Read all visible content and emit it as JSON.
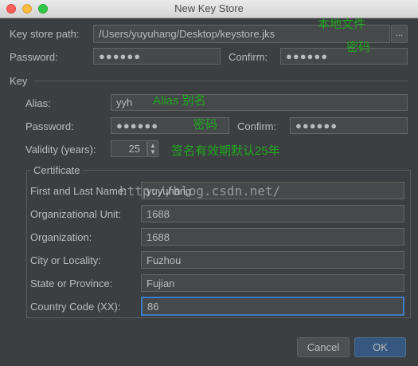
{
  "window": {
    "title": "New Key Store"
  },
  "keystore": {
    "path_label": "Key store path:",
    "path_value": "/Users/yuyuhang/Desktop/keystore.jks",
    "browse_label": "...",
    "password_label": "Password:",
    "password_value": "●●●●●●",
    "confirm_label": "Confirm:",
    "confirm_value": "●●●●●●"
  },
  "key": {
    "section_label": "Key",
    "alias_label": "Alias:",
    "alias_value": "yyh",
    "password_label": "Password:",
    "password_value": "●●●●●●",
    "confirm_label": "Confirm:",
    "confirm_value": "●●●●●●",
    "validity_label": "Validity (years):",
    "validity_value": "25"
  },
  "certificate": {
    "legend": "Certificate",
    "fields": [
      {
        "label": "First and Last Name:",
        "value": "yuyuhang"
      },
      {
        "label": "Organizational Unit:",
        "value": "1688"
      },
      {
        "label": "Organization:",
        "value": "1688"
      },
      {
        "label": "City or Locality:",
        "value": "Fuzhou"
      },
      {
        "label": "State or Province:",
        "value": "Fujian"
      },
      {
        "label": "Country Code (XX):",
        "value": "86"
      }
    ]
  },
  "annotations": {
    "local_file": "本地文件",
    "keystore_password": "密码",
    "alias_note": "Alias 别名",
    "key_password": "密码",
    "validity_note": "签名有效期默认25年"
  },
  "watermark": "http://blog.csdn.net/",
  "buttons": {
    "cancel": "Cancel",
    "ok": "OK"
  },
  "colors": {
    "accent": "#3d7cc4",
    "annotation": "#1fa81f",
    "ok_button": "#365880"
  }
}
